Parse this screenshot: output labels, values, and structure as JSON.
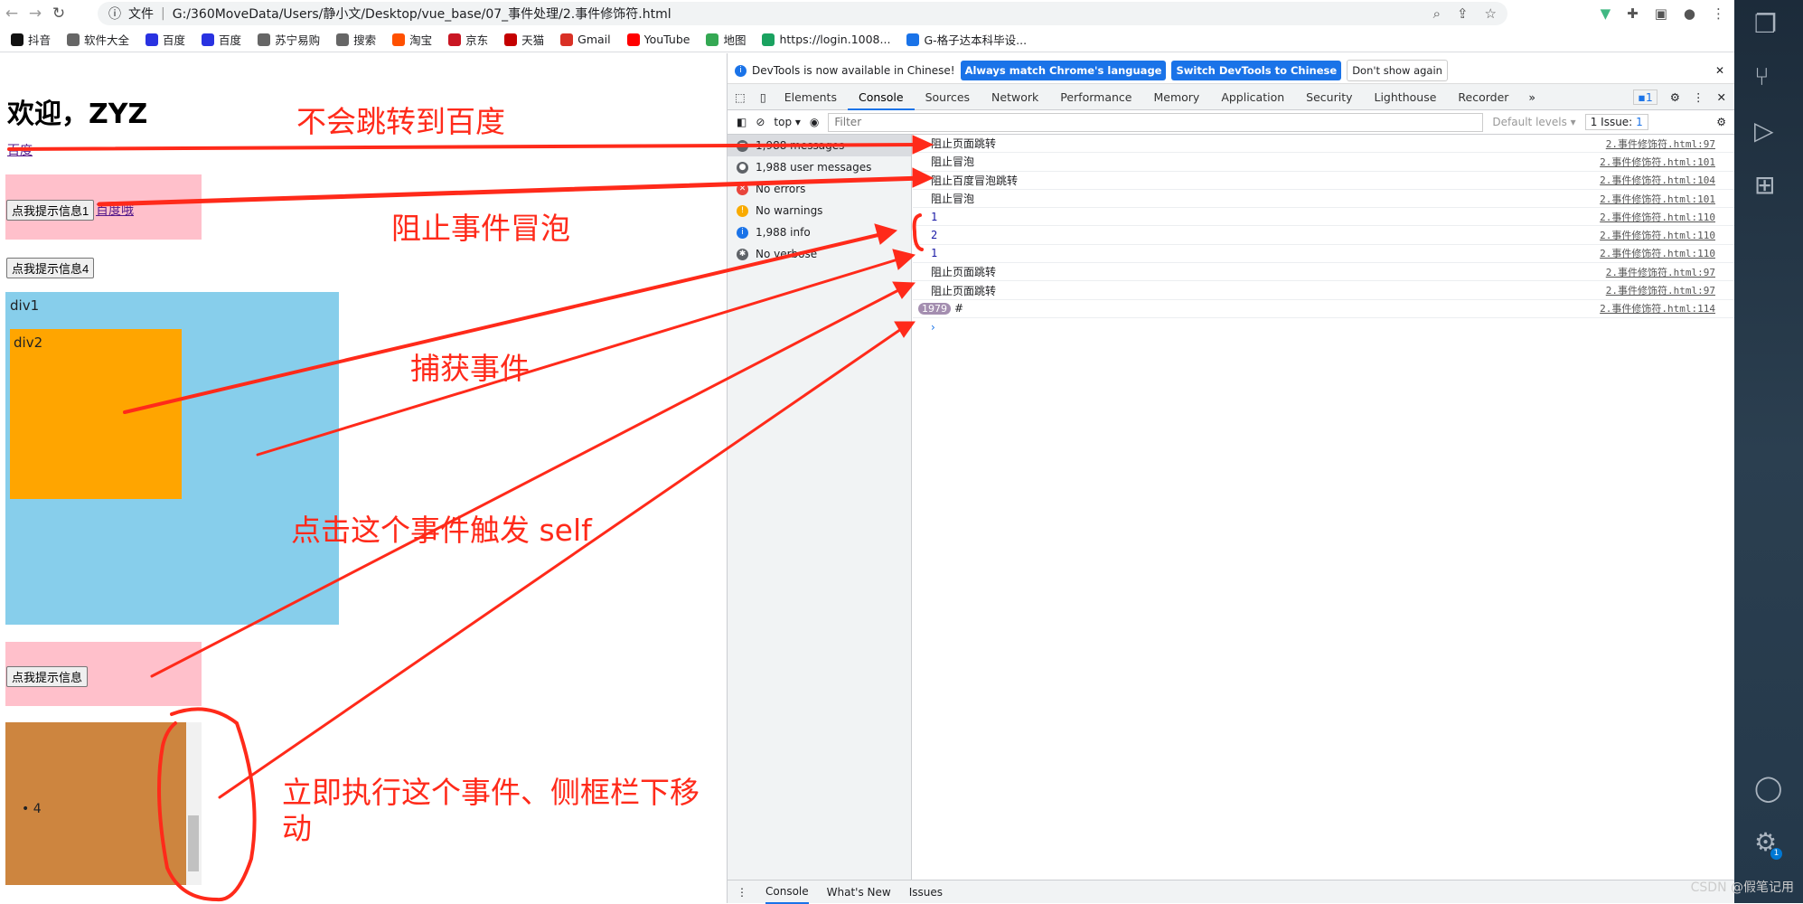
{
  "browser": {
    "info_label": "文件",
    "url": "G:/360MoveData/Users/静小文/Desktop/vue_base/07_事件处理/2.事件修饰符.html",
    "bookmarks": [
      {
        "label": "抖音",
        "color": "#111"
      },
      {
        "label": "软件大全",
        "color": "#666"
      },
      {
        "label": "百度",
        "color": "#2932e1"
      },
      {
        "label": "百度",
        "color": "#2932e1"
      },
      {
        "label": "苏宁易购",
        "color": "#666"
      },
      {
        "label": "搜索",
        "color": "#666"
      },
      {
        "label": "淘宝",
        "color": "#ff5000"
      },
      {
        "label": "京东",
        "color": "#c91623"
      },
      {
        "label": "天猫",
        "color": "#c40000"
      },
      {
        "label": "Gmail",
        "color": "#d93025"
      },
      {
        "label": "YouTube",
        "color": "#ff0000"
      },
      {
        "label": "地图",
        "color": "#34a853"
      },
      {
        "label": "https://login.1008...",
        "color": "#1aa260"
      },
      {
        "label": "G-格子达本科毕设...",
        "color": "#1a73e8"
      }
    ]
  },
  "page": {
    "title": "欢迎，ZYZ",
    "link1": "百度",
    "button1": "点我提示信息1",
    "link2": "百度哦",
    "button4": "点我提示信息4",
    "div1": "div1",
    "div2": "div2",
    "button_self": "点我提示信息",
    "list_item": "4"
  },
  "devtools": {
    "info_text": "DevTools is now available in Chinese!",
    "btn_match": "Always match Chrome's language",
    "btn_switch": "Switch DevTools to Chinese",
    "btn_dont": "Don't show again",
    "tabs": [
      "Elements",
      "Console",
      "Sources",
      "Network",
      "Performance",
      "Memory",
      "Application",
      "Security",
      "Lighthouse",
      "Recorder"
    ],
    "active_tab": "Console",
    "issues_badge": "1",
    "context": "top",
    "filter_placeholder": "Filter",
    "levels": "Default levels",
    "issues": "1 Issue:",
    "issues_count": "1",
    "sidebar": [
      {
        "label": "1,988 messages"
      },
      {
        "label": "1,988 user messages"
      },
      {
        "label": "No errors"
      },
      {
        "label": "No warnings"
      },
      {
        "label": "1,988 info"
      },
      {
        "label": "No verbose"
      }
    ],
    "logs": [
      {
        "text": "阻止页面跳转",
        "src": "2.事件修饰符.html:97"
      },
      {
        "text": "阻止冒泡",
        "src": "2.事件修饰符.html:101"
      },
      {
        "text": "阻止百度冒泡跳转",
        "src": "2.事件修饰符.html:104"
      },
      {
        "text": "阻止冒泡",
        "src": "2.事件修饰符.html:101"
      },
      {
        "text": "1",
        "src": "2.事件修饰符.html:110",
        "num": true
      },
      {
        "text": "2",
        "src": "2.事件修饰符.html:110",
        "num": true
      },
      {
        "text": "1",
        "src": "2.事件修饰符.html:110",
        "num": true
      },
      {
        "text": "阻止页面跳转",
        "src": "2.事件修饰符.html:97"
      },
      {
        "text": "阻止页面跳转",
        "src": "2.事件修饰符.html:97"
      },
      {
        "text": "#",
        "src": "2.事件修饰符.html:114",
        "badge": "1979"
      }
    ],
    "drawer": [
      "Console",
      "What's New",
      "Issues"
    ]
  },
  "annotations": {
    "a1": "不会跳转到百度",
    "a2": "阻止事件冒泡",
    "a3": "捕获事件",
    "a4": "点击这个事件触发 self",
    "a5": "立即执行这个事件、侧框栏下移",
    "a5b": "动",
    "color": "#ff2a1a"
  },
  "vscode": {
    "badge": "1"
  },
  "watermark": "CSDN @假笔记用"
}
